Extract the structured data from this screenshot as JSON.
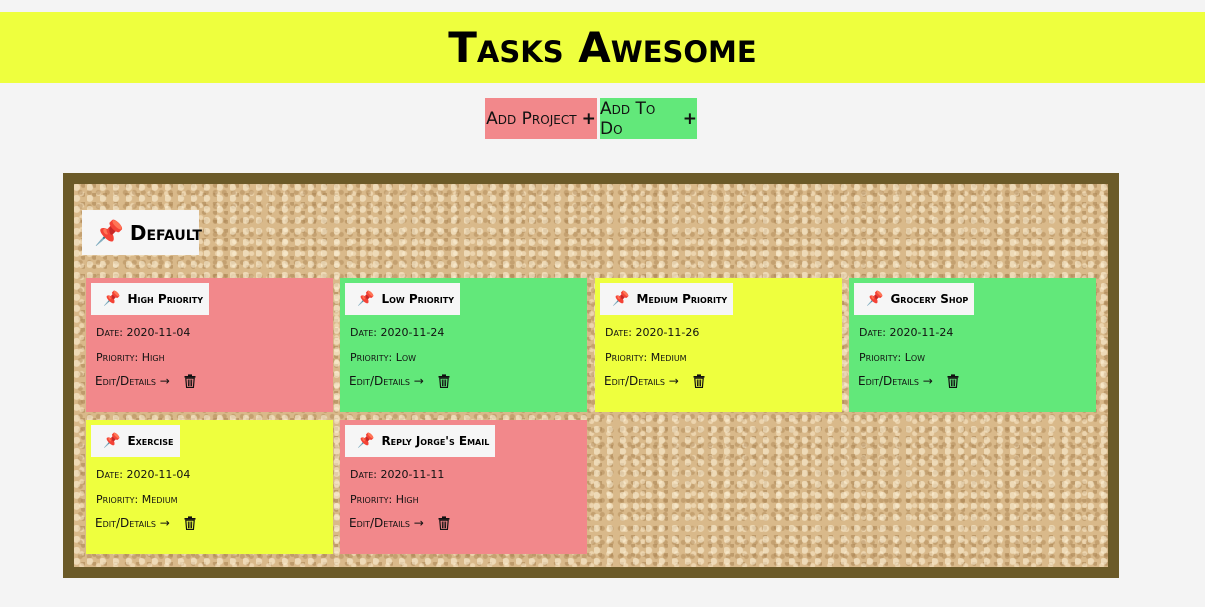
{
  "app": {
    "title": "Tasks Awesome"
  },
  "toolbar": {
    "add_project_label": "Add Project",
    "add_project_icon": "+",
    "add_todo_label": "Add To Do",
    "add_todo_icon": "+"
  },
  "project": {
    "name": "Default",
    "icon": "pushpin-icon",
    "pin_glyph": "📌"
  },
  "labels": {
    "date_prefix": "Date: ",
    "priority_prefix": "Priority: ",
    "edit_link": "Edit/Details →"
  },
  "colors": {
    "header": "#eeff3e",
    "add_project": "#f2888b",
    "add_todo": "#62e87a",
    "high": "#f2888b",
    "medium": "#eeff3e",
    "low": "#62e87a",
    "board_frame": "#6b5a28"
  },
  "todos": [
    {
      "title": "High Priority",
      "date": "2020-11-04",
      "priority": "High"
    },
    {
      "title": "Low Priority",
      "date": "2020-11-24",
      "priority": "Low"
    },
    {
      "title": "Medium Priority",
      "date": "2020-11-26",
      "priority": "Medium"
    },
    {
      "title": "Grocery Shop",
      "date": "2020-11-24",
      "priority": "Low"
    },
    {
      "title": "Exercise",
      "date": "2020-11-04",
      "priority": "Medium"
    },
    {
      "title": "Reply Jorge's Email",
      "date": "2020-11-11",
      "priority": "High"
    }
  ]
}
